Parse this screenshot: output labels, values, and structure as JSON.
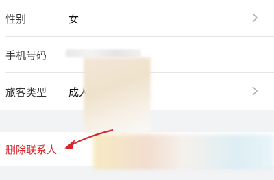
{
  "rows": {
    "gender": {
      "label": "性别",
      "value": "女"
    },
    "phone": {
      "label": "手机号码"
    },
    "traveler_type": {
      "label": "旅客类型",
      "value": "成人"
    },
    "delete": {
      "label": "删除联系人"
    }
  },
  "colors": {
    "delete_text": "#d9262c",
    "arrow": "#d9262c",
    "chevron": "#b0b0b0"
  },
  "icons": {
    "chevron": "chevron-right-icon",
    "annotation": "red-arrow-annotation"
  }
}
